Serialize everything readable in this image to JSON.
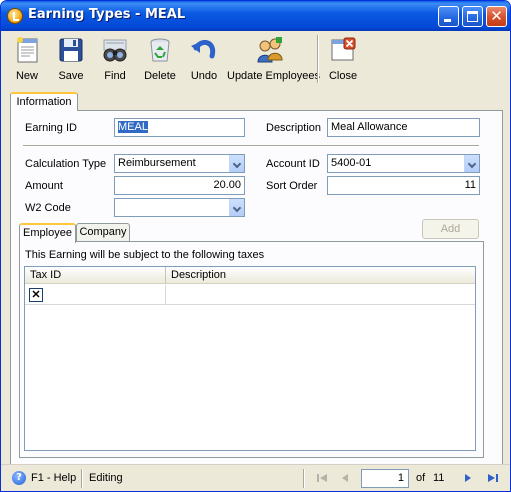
{
  "window": {
    "title": "Earning Types - MEAL"
  },
  "toolbar": {
    "new": "New",
    "save": "Save",
    "find": "Find",
    "delete": "Delete",
    "undo": "Undo",
    "update_employees": "Update Employees",
    "close": "Close"
  },
  "tabs": {
    "information": "Information"
  },
  "form": {
    "earning_id_label": "Earning ID",
    "earning_id_value": "MEAL",
    "description_label": "Description",
    "description_value": "Meal Allowance",
    "calc_type_label": "Calculation Type",
    "calc_type_value": "Reimbursement",
    "account_id_label": "Account ID",
    "account_id_value": "5400-01",
    "amount_label": "Amount",
    "amount_value": "20.00",
    "sort_order_label": "Sort Order",
    "sort_order_value": "11",
    "w2_code_label": "W2 Code",
    "w2_code_value": ""
  },
  "taxes": {
    "add_label": "Add",
    "tabs": [
      "Employee",
      "Company"
    ],
    "subject_text": "This Earning will be subject to the following taxes",
    "columns": [
      "Tax ID",
      "Description"
    ],
    "rows": [
      {
        "tax_id": "",
        "description": ""
      }
    ],
    "delete_glyph": "✕"
  },
  "status": {
    "help": "F1 - Help",
    "mode": "Editing",
    "page": "1",
    "of_label": "of",
    "total": "11"
  },
  "icons": {
    "app": "app-icon",
    "new": "new-document-icon",
    "save": "floppy-disk-icon",
    "find": "binoculars-icon",
    "delete": "recycle-bin-icon",
    "undo": "undo-arrow-icon",
    "update": "update-employees-icon",
    "close": "close-window-icon",
    "help": "help-icon"
  },
  "colors": {
    "title_bar": "#0348d8",
    "accent_tab": "#ffc83c",
    "selection": "#316ac5"
  }
}
